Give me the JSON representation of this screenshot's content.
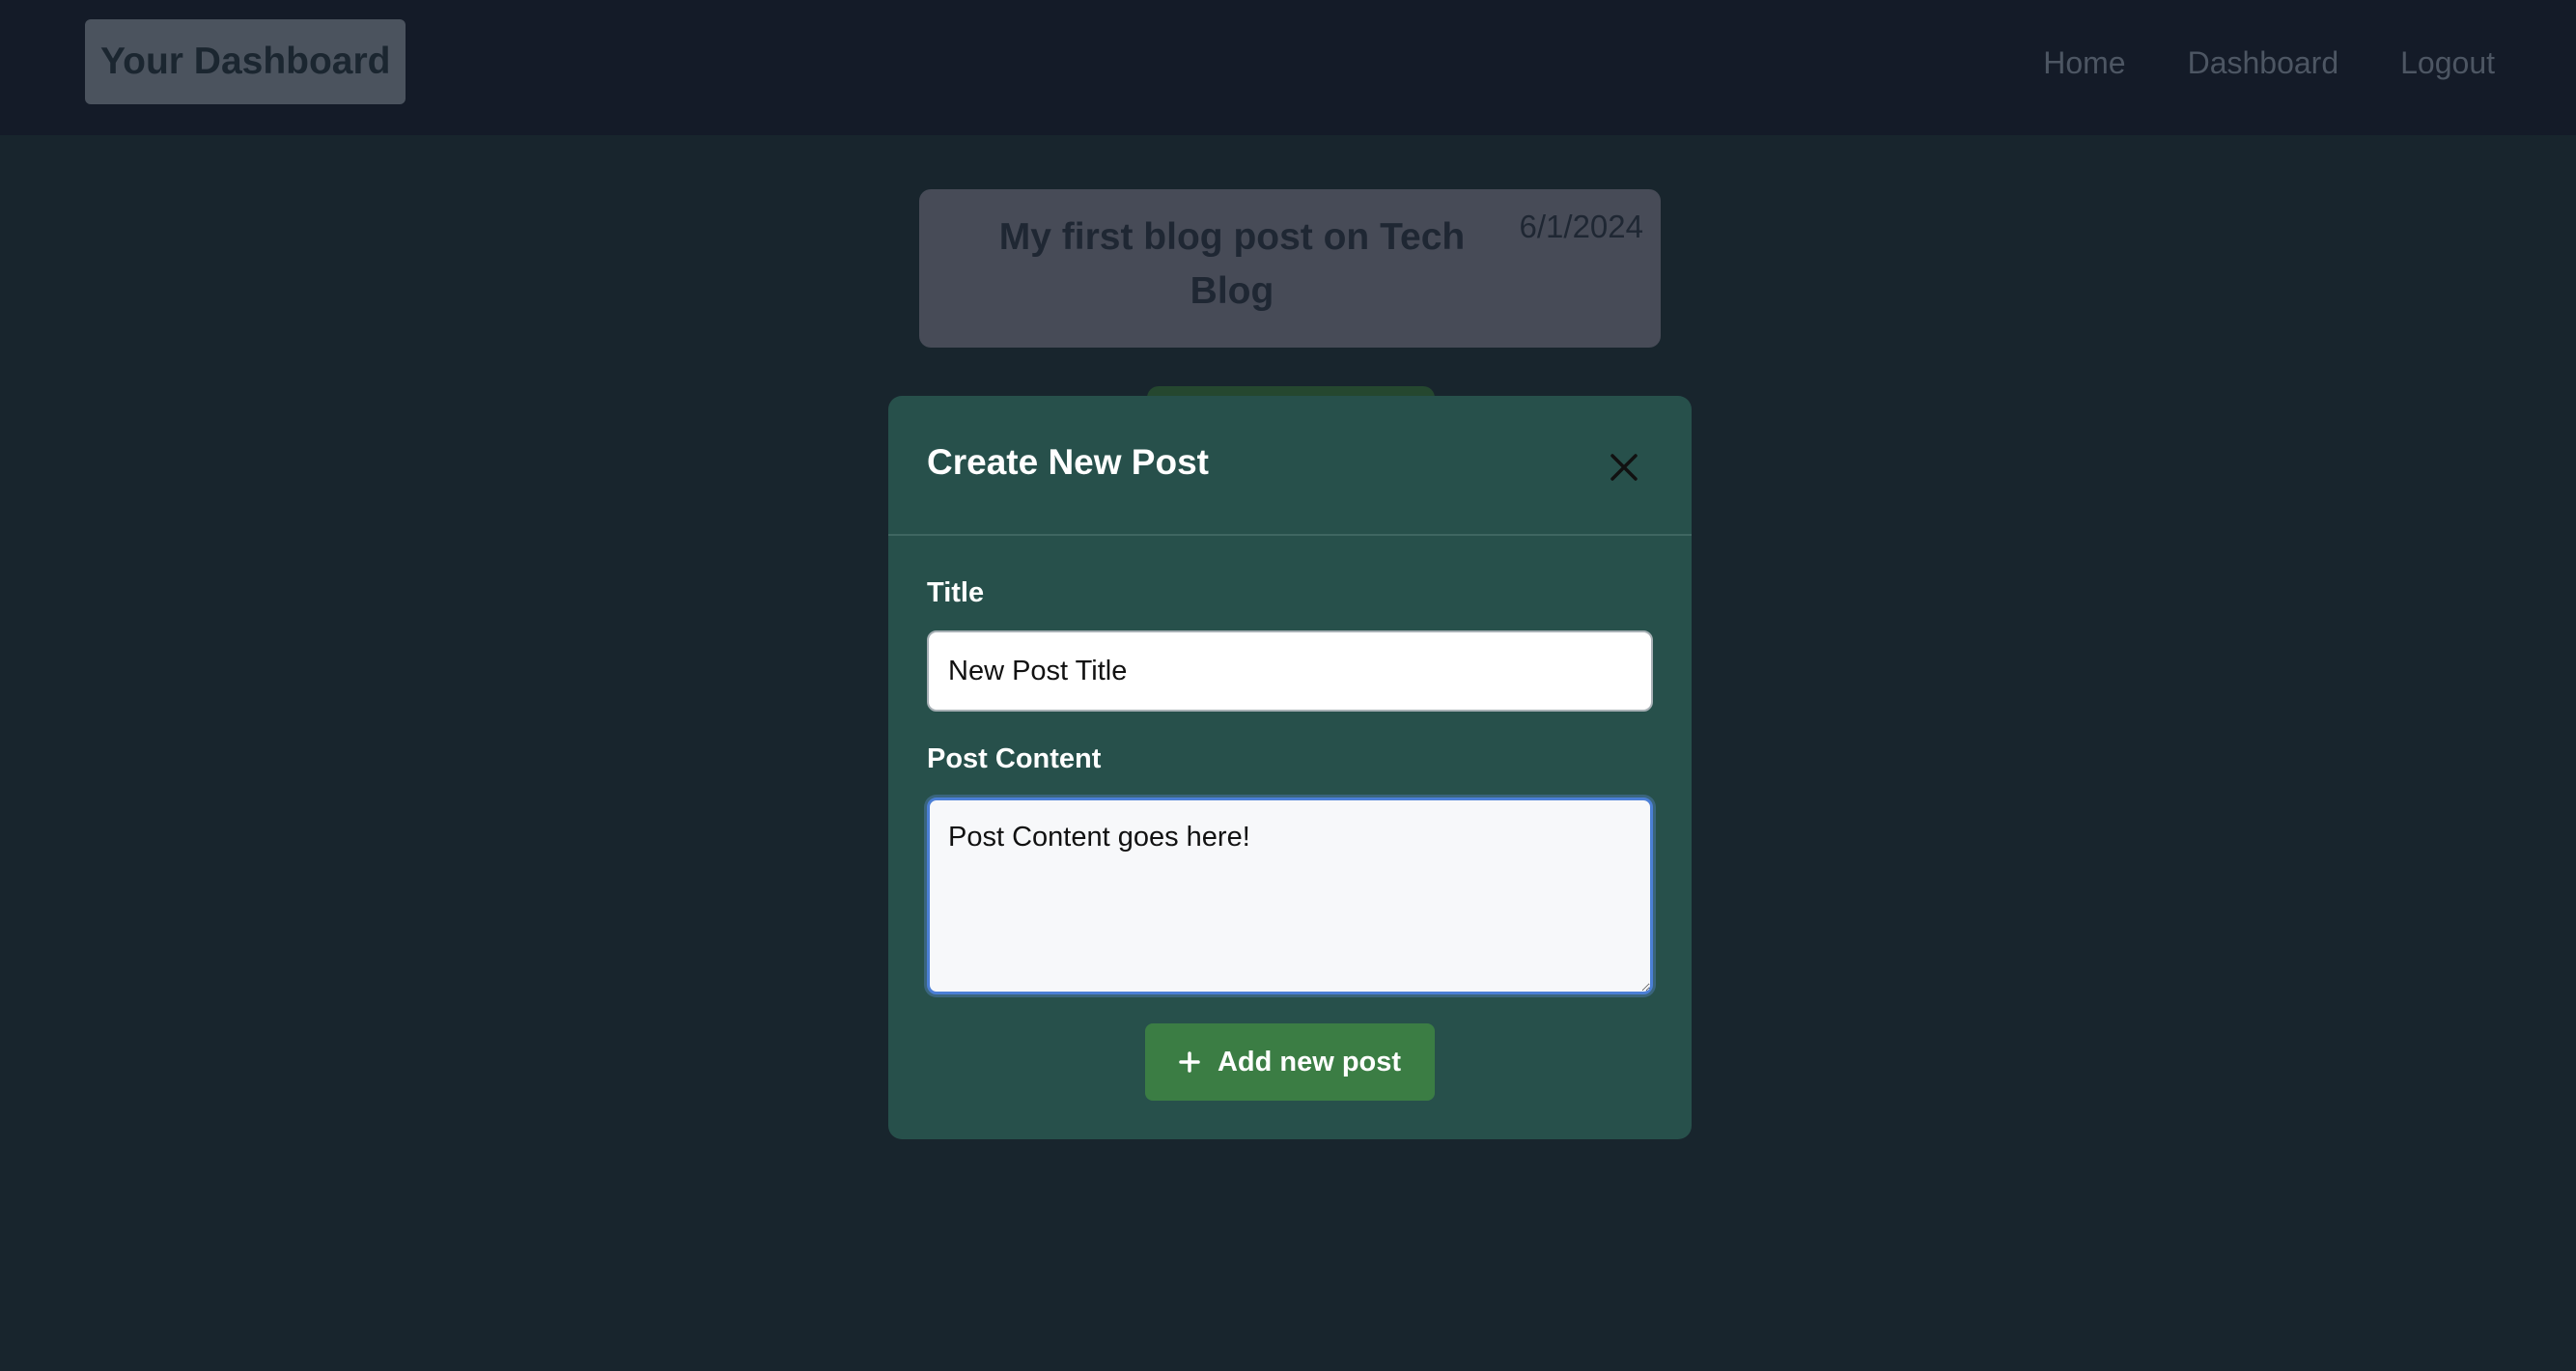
{
  "navbar": {
    "brand": "Your Dashboard",
    "links": [
      {
        "label": "Home"
      },
      {
        "label": "Dashboard"
      },
      {
        "label": "Logout"
      }
    ]
  },
  "post": {
    "title": "My first blog post on Tech Blog",
    "date": "6/1/2024"
  },
  "modal": {
    "title": "Create New Post",
    "close_icon": "close-icon",
    "title_label": "Title",
    "title_value": "New Post Title",
    "content_label": "Post Content",
    "content_value": "Post Content goes here!",
    "submit_label": "Add new post",
    "submit_icon": "plus-icon"
  },
  "colors": {
    "background": "#18252d",
    "navbar": "#141b28",
    "modal": "#27504b",
    "accent_button": "#3b7d44",
    "focus_ring": "#4b7fd6"
  }
}
